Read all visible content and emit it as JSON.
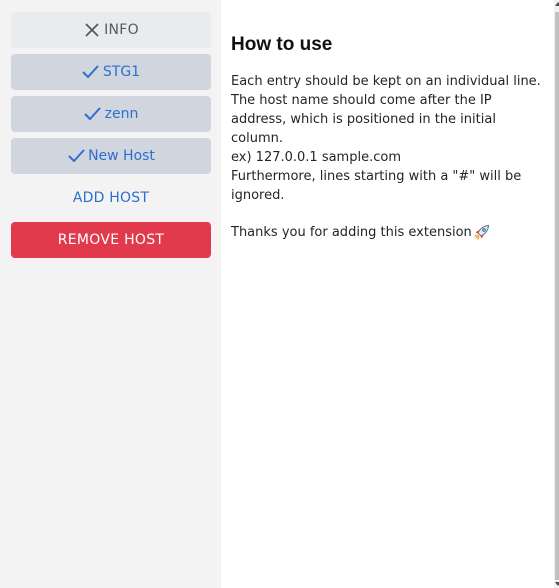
{
  "sidebar": {
    "info_button": {
      "label": "INFO",
      "icon": "close-icon"
    },
    "hosts": [
      {
        "label": "STG1",
        "icon": "check-icon"
      },
      {
        "label": "zenn",
        "icon": "check-icon"
      },
      {
        "label": "New Host",
        "icon": "check-icon"
      }
    ],
    "add_host_label": "ADD HOST",
    "remove_host_label": "REMOVE HOST"
  },
  "main": {
    "title": "How to use",
    "lines": [
      "Each entry should be kept on an individual line.",
      "The host name should come after the IP",
      "address, which is positioned in the initial",
      "column.",
      "ex) 127.0.0.1 sample.com",
      "Furthermore, lines starting with a \"#\" will be",
      "ignored."
    ],
    "thanks": "Thanks you for adding this extension",
    "thanks_icon": "rocket-icon"
  },
  "colors": {
    "accent": "#2d6fd1",
    "danger": "#e03a4c",
    "sidebar_bg": "#f3f3f3",
    "host_button_bg": "#d1d5dd",
    "info_button_bg": "#e9ecef"
  }
}
